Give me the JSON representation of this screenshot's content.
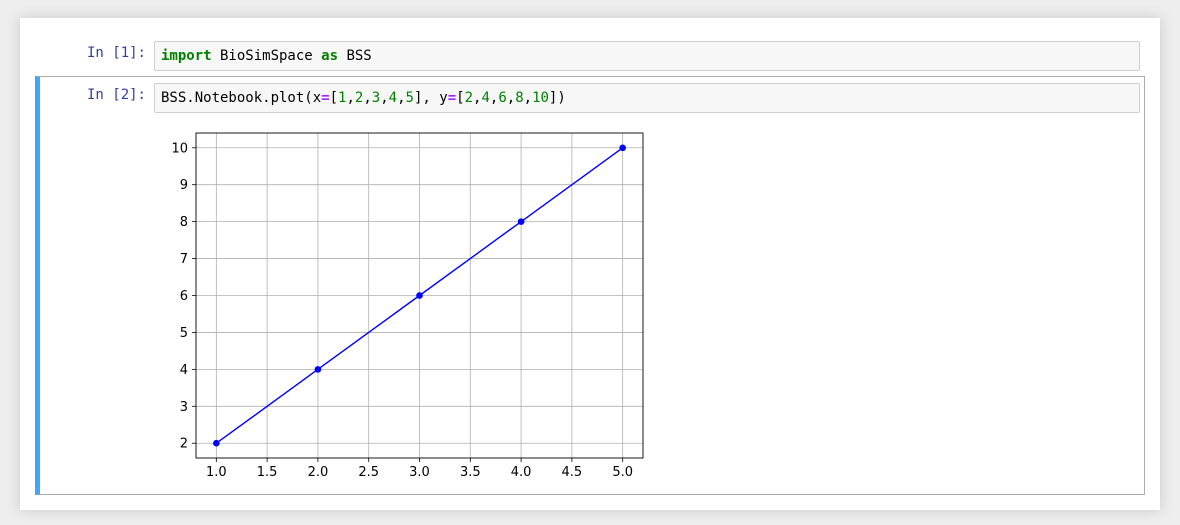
{
  "cells": [
    {
      "prompt": "In [1]:",
      "code": [
        {
          "text": "import",
          "cls": "kw"
        },
        {
          "text": " BioSimSpace ",
          "cls": ""
        },
        {
          "text": "as",
          "cls": "kw"
        },
        {
          "text": " BSS",
          "cls": ""
        }
      ]
    },
    {
      "prompt": "In [2]:",
      "code": [
        {
          "text": "BSS.Notebook.plot(x",
          "cls": ""
        },
        {
          "text": "=",
          "cls": "op"
        },
        {
          "text": "[",
          "cls": ""
        },
        {
          "text": "1",
          "cls": "num"
        },
        {
          "text": ",",
          "cls": ""
        },
        {
          "text": "2",
          "cls": "num"
        },
        {
          "text": ",",
          "cls": ""
        },
        {
          "text": "3",
          "cls": "num"
        },
        {
          "text": ",",
          "cls": ""
        },
        {
          "text": "4",
          "cls": "num"
        },
        {
          "text": ",",
          "cls": ""
        },
        {
          "text": "5",
          "cls": "num"
        },
        {
          "text": "], y",
          "cls": ""
        },
        {
          "text": "=",
          "cls": "op"
        },
        {
          "text": "[",
          "cls": ""
        },
        {
          "text": "2",
          "cls": "num"
        },
        {
          "text": ",",
          "cls": ""
        },
        {
          "text": "4",
          "cls": "num"
        },
        {
          "text": ",",
          "cls": ""
        },
        {
          "text": "6",
          "cls": "num"
        },
        {
          "text": ",",
          "cls": ""
        },
        {
          "text": "8",
          "cls": "num"
        },
        {
          "text": ",",
          "cls": ""
        },
        {
          "text": "10",
          "cls": "num"
        },
        {
          "text": "])",
          "cls": ""
        }
      ]
    }
  ],
  "colors": {
    "accent": "#42a5f5",
    "prompt": "#303f9f",
    "line": "#0000ff",
    "grid": "#b0b0b0"
  },
  "chart_data": {
    "type": "line",
    "x": [
      1,
      2,
      3,
      4,
      5
    ],
    "series": [
      {
        "values": [
          2,
          4,
          6,
          8,
          10
        ],
        "marker": "o"
      }
    ],
    "xticks": [
      "1.0",
      "1.5",
      "2.0",
      "2.5",
      "3.0",
      "3.5",
      "4.0",
      "4.5",
      "5.0"
    ],
    "yticks": [
      "2",
      "3",
      "4",
      "5",
      "6",
      "7",
      "8",
      "9",
      "10"
    ],
    "xlim": [
      0.8,
      5.2
    ],
    "ylim": [
      1.6,
      10.4
    ],
    "grid": true,
    "title": "",
    "xlabel": "",
    "ylabel": ""
  }
}
